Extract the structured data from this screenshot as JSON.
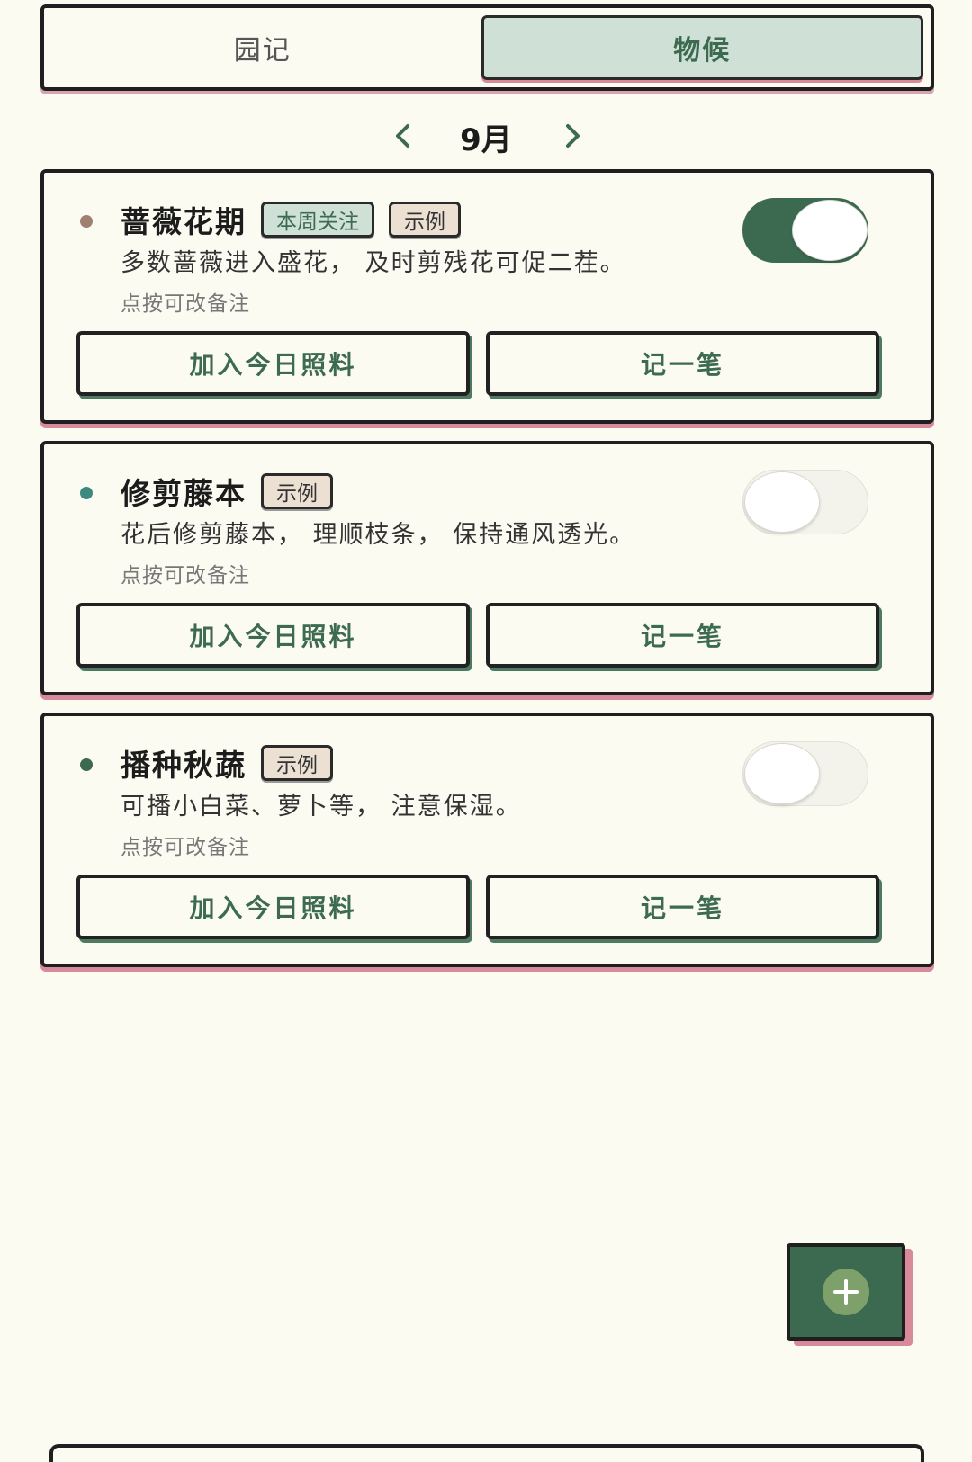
{
  "tabs": [
    {
      "label": "园记",
      "active": false
    },
    {
      "label": "物候",
      "active": true
    }
  ],
  "month_nav": {
    "label": "9月"
  },
  "cards": [
    {
      "title": "蔷薇花期",
      "badges": [
        "本周关注",
        "示例"
      ],
      "description": "多数蔷薇进入盛花，  及时剪残花可促二茬。",
      "note": "点按可改备注",
      "enabled": true,
      "dot_color": "#a08070",
      "add_label": "加入今日照料",
      "log_label": "记一笔"
    },
    {
      "title": "修剪藤本",
      "badges": [
        "示例"
      ],
      "description": "花后修剪藤本，  理顺枝条，  保持通风透光。",
      "note": "点按可改备注",
      "enabled": false,
      "dot_color": "#3c8a7e",
      "add_label": "加入今日照料",
      "log_label": "记一笔"
    },
    {
      "title": "播种秋蔬",
      "badges": [
        "示例"
      ],
      "description": "可播小白菜、萝卜等，  注意保湿。",
      "note": "点按可改备注",
      "enabled": false,
      "dot_color": "#3c6a51",
      "add_label": "加入今日照料",
      "log_label": "记一笔"
    }
  ],
  "colors": {
    "accent_green": "#3c6a51",
    "accent_pink": "#d88a9a",
    "background": "#fcfbf2"
  },
  "icons": {
    "prev": "chevron-left-icon",
    "next": "chevron-right-icon",
    "fab": "plus-icon"
  }
}
